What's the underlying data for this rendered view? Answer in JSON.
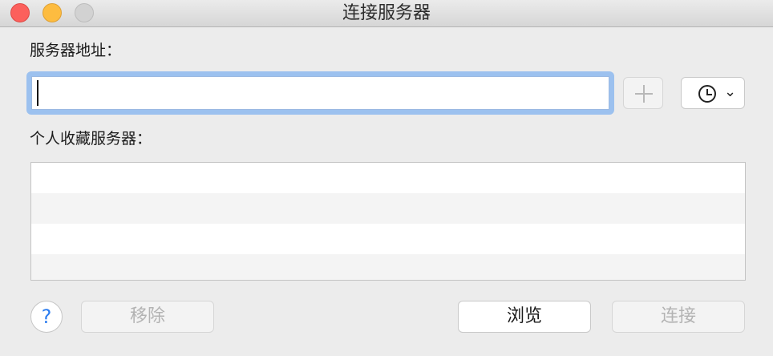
{
  "window": {
    "title": "连接服务器"
  },
  "server": {
    "label": "服务器地址：",
    "address_value": ""
  },
  "favorites": {
    "label": "个人收藏服务器：",
    "rows": [
      "",
      "",
      "",
      ""
    ]
  },
  "buttons": {
    "remove": "移除",
    "browse": "浏览",
    "connect": "连接",
    "help": "?"
  },
  "icons": {
    "add": "plus-icon",
    "recent": "clock-icon",
    "recent_menu": "chevron-down-icon"
  },
  "colors": {
    "focus_ring": "#9cc1ef",
    "close": "#fc605c",
    "minimize": "#fdbc40",
    "zoom": "#d2d2d2",
    "help_glyph": "#2a7cf0"
  }
}
